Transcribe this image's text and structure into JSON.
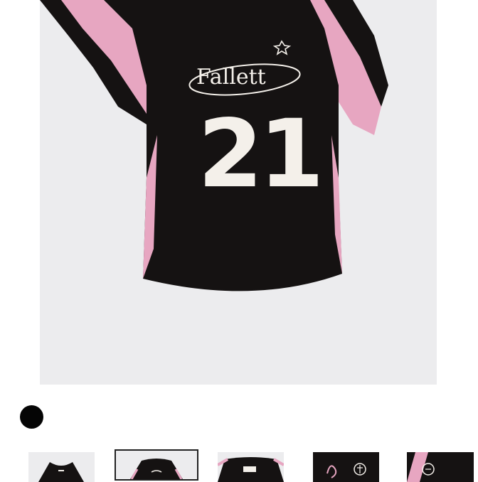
{
  "product": {
    "name_print": "Fallett",
    "jersey_number": "21",
    "color_options": [
      {
        "name": "black",
        "hex": "#050505",
        "selected": true
      }
    ]
  },
  "colors": {
    "jersey_body": "#151212",
    "jersey_accent": "#e7a6c1",
    "print": "#f4f0ea",
    "image_bg": "#ececee"
  },
  "gallery": {
    "selected_index": 1,
    "thumbnails": [
      {
        "icon": "jersey-front-thumb"
      },
      {
        "icon": "jersey-back-thumb"
      },
      {
        "icon": "jersey-collar-thumb"
      },
      {
        "icon": "jersey-print-detail-thumb"
      },
      {
        "icon": "jersey-sleeve-detail-thumb"
      }
    ]
  }
}
